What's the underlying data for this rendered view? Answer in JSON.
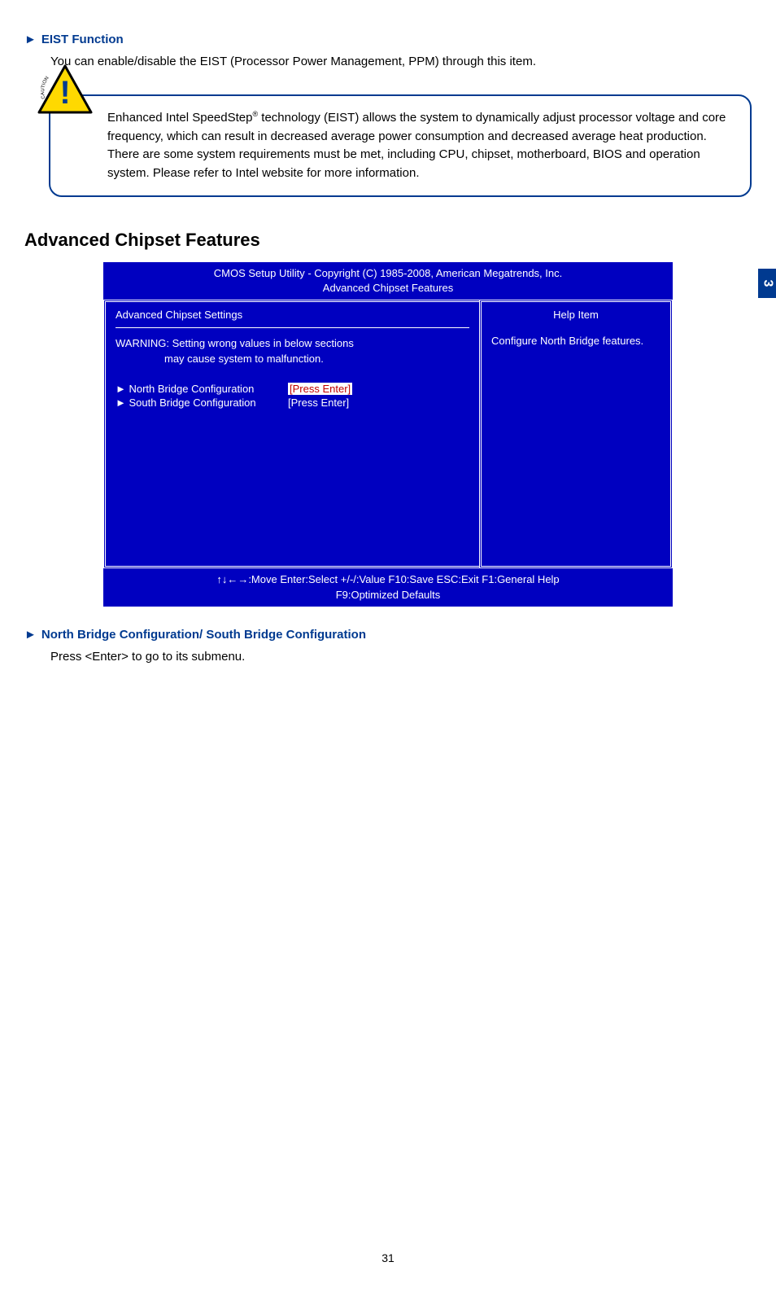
{
  "section1": {
    "header": "EIST Function",
    "body": "You can enable/disable the EIST (Processor Power Management, PPM) through this item."
  },
  "caution": {
    "label": "CAUTION",
    "text_pre": "Enhanced Intel SpeedStep",
    "text_post": " technology (EIST) allows the system to dynamically adjust processor voltage and core frequency, which can result in decreased average power consumption and decreased average heat production.  There are some system requirements must be met, including CPU, chipset, motherboard, BIOS and operation system. Please refer to Intel website for more information."
  },
  "heading": "Advanced Chipset Features",
  "bios": {
    "title_line1": "CMOS Setup Utility - Copyright (C) 1985-2008, American Megatrends, Inc.",
    "title_line2": "Advanced Chipset Features",
    "left_header": "Advanced Chipset Settings",
    "right_header": "Help Item",
    "warning_line1": "WARNING: Setting wrong values in below sections",
    "warning_line2": "may cause system to malfunction.",
    "items": [
      {
        "label": "North Bridge Configuration",
        "value": "[Press Enter]",
        "highlight": true
      },
      {
        "label": "South Bridge Configuration",
        "value": "[Press Enter]",
        "highlight": false
      }
    ],
    "help_text": "Configure North Bridge features.",
    "footer_line1": "↑↓←→:Move   Enter:Select    +/-/:Value   F10:Save   ESC:Exit    F1:General Help",
    "footer_line2": "F9:Optimized Defaults"
  },
  "section2": {
    "header": "North Bridge Configuration/ South Bridge Configuration",
    "body": "Press <Enter> to go to its submenu."
  },
  "side_tab": "3",
  "page_number": "31",
  "arrow": "►"
}
